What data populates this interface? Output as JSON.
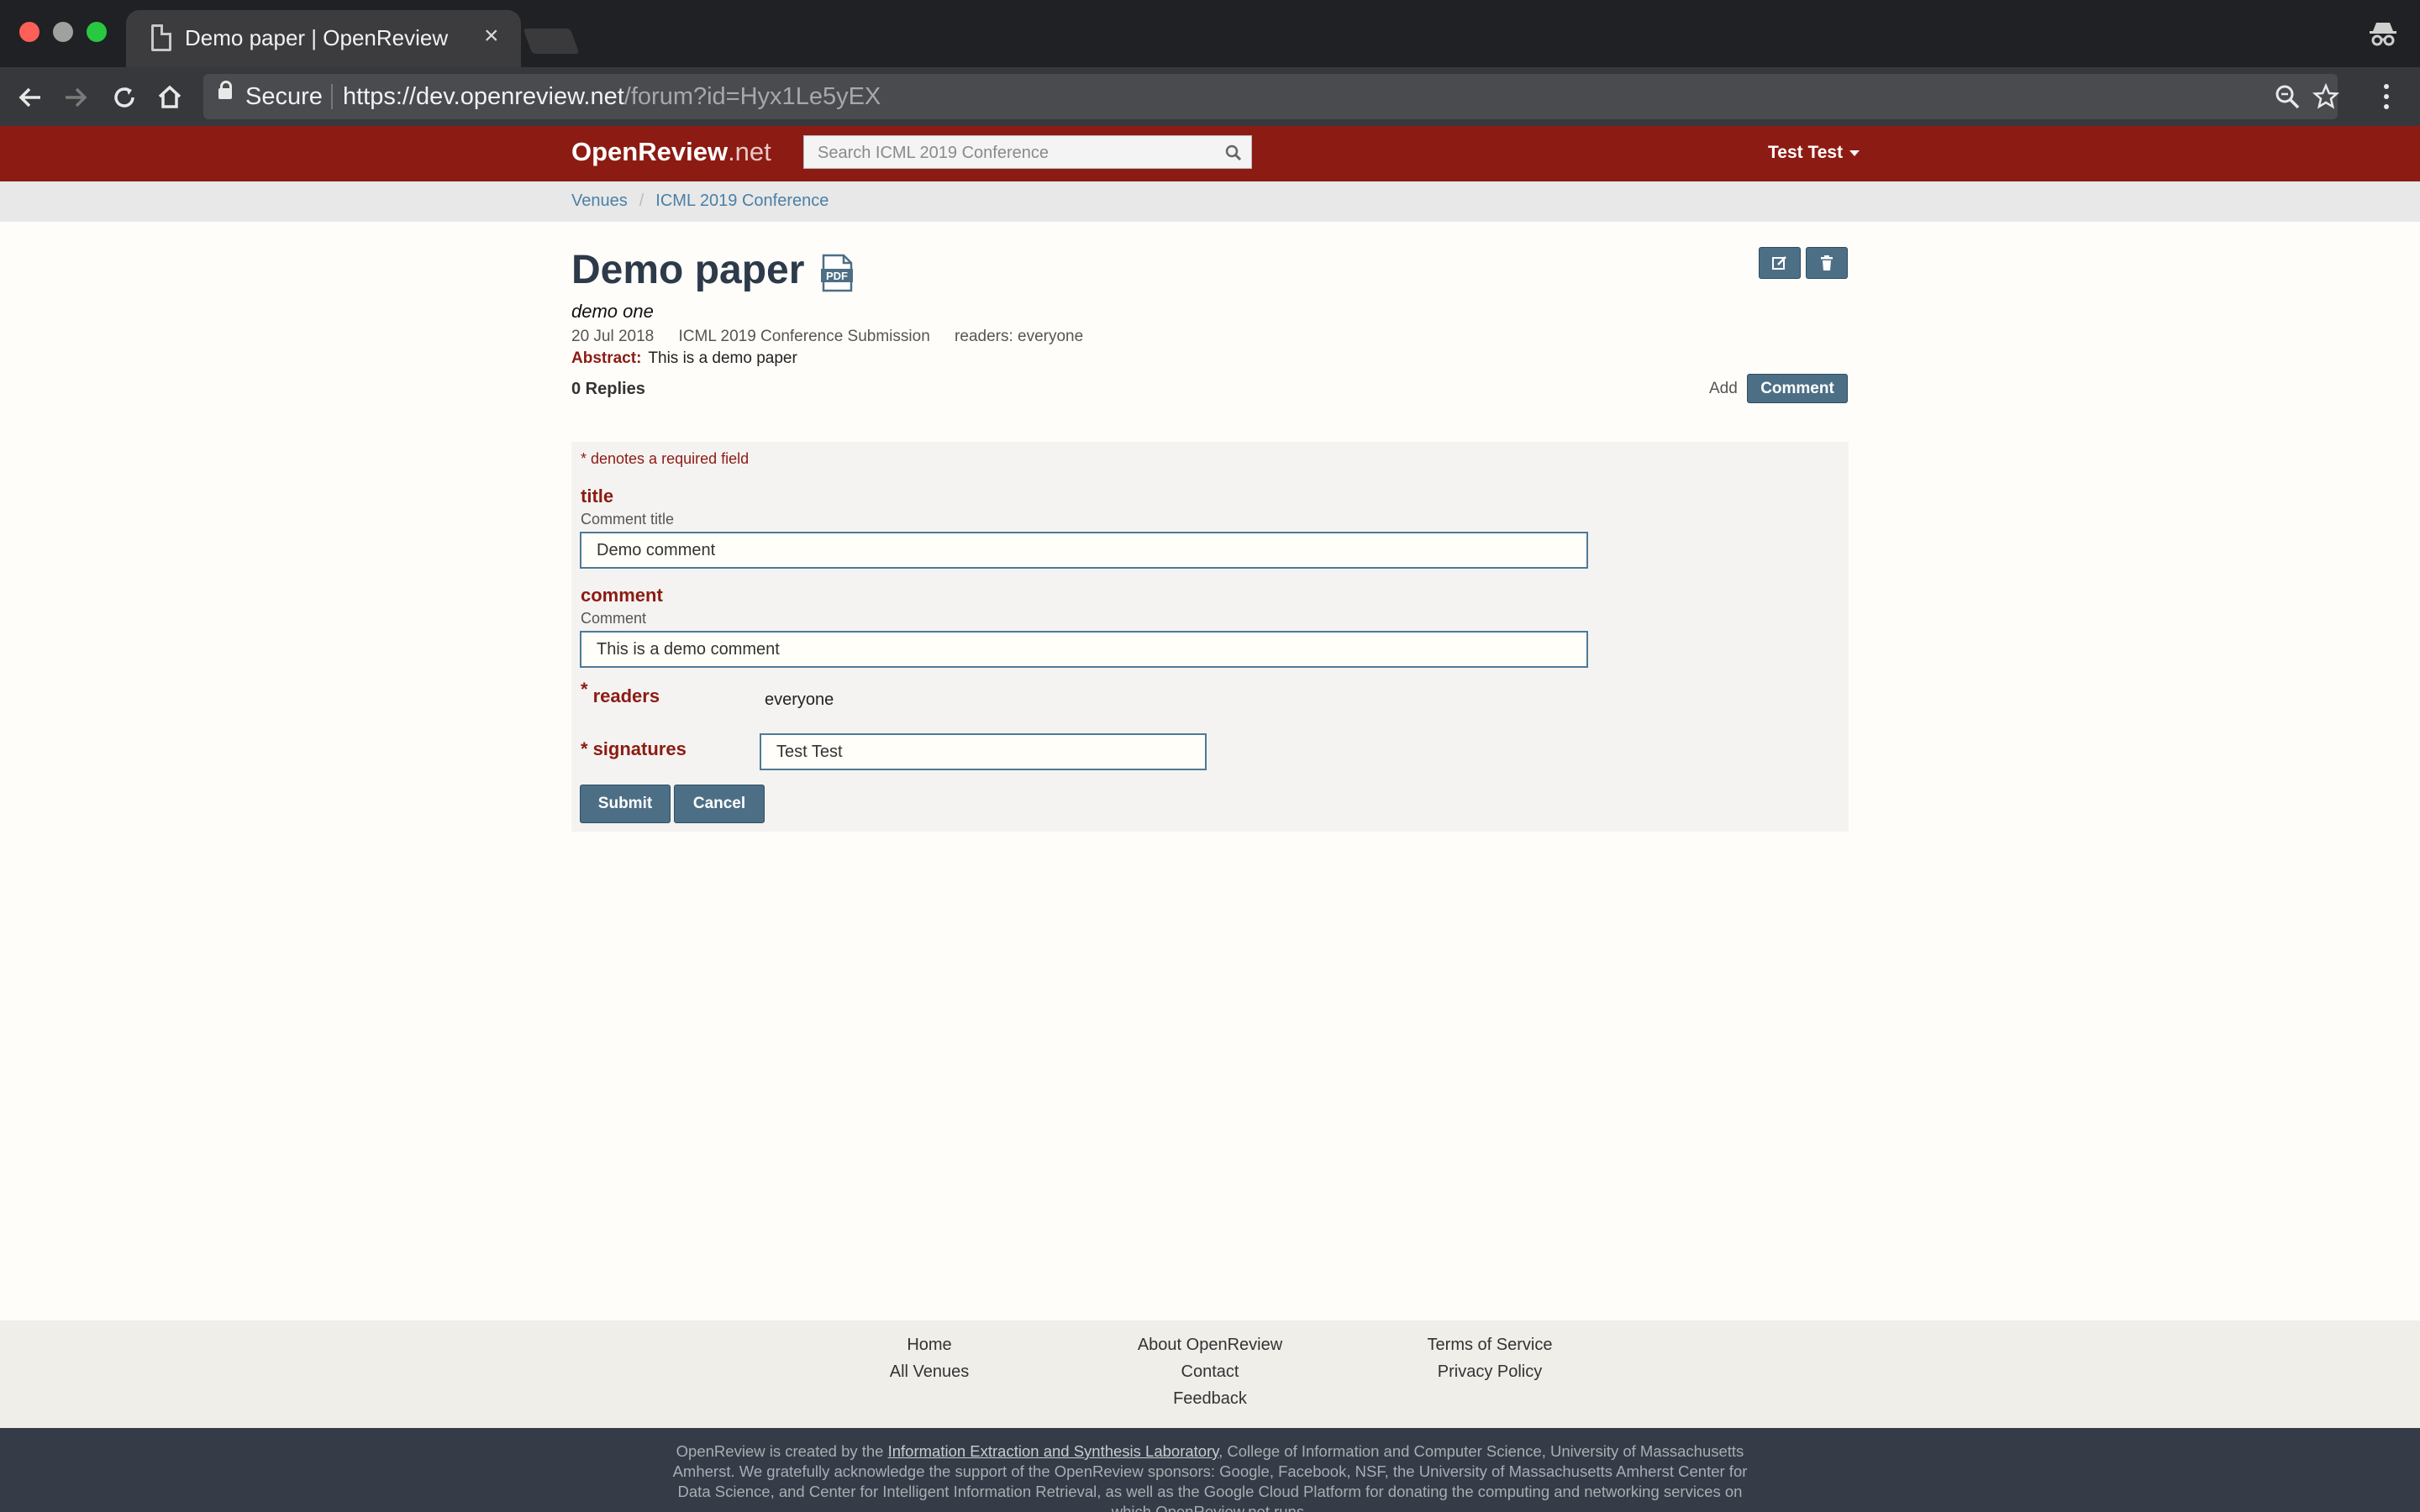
{
  "browser": {
    "tab_title": "Demo paper | OpenReview",
    "secure_label": "Secure",
    "url_main": "https://dev.openreview.net",
    "url_path": "/forum?id=Hyx1Le5yEX"
  },
  "header": {
    "brand_main": "OpenReview",
    "brand_suffix": ".net",
    "search_placeholder": "Search ICML 2019 Conference",
    "user_name": "Test Test"
  },
  "breadcrumb": [
    "Venues",
    "ICML 2019 Conference"
  ],
  "note": {
    "title": "Demo paper",
    "authors": "demo one",
    "date": "20 Jul 2018",
    "invitation": "ICML 2019 Conference Submission",
    "readers": "readers: everyone",
    "abstract_label": "Abstract:",
    "abstract": "This is a demo paper",
    "replies": "0 Replies",
    "add_label": "Add",
    "comment_button": "Comment"
  },
  "form": {
    "required_note": "* denotes a required field",
    "title_label": "title",
    "title_desc": "Comment title",
    "title_value": "Demo comment",
    "comment_label": "comment",
    "comment_desc": "Comment",
    "comment_value": "This is a demo comment",
    "readers_star": "*",
    "readers_label": "readers",
    "readers_value": "everyone",
    "signatures_star": "*",
    "signatures_label": "signatures",
    "signatures_value": "Test Test",
    "submit": "Submit",
    "cancel": "Cancel"
  },
  "footer": {
    "col1": [
      "Home",
      "All Venues"
    ],
    "col2": [
      "About OpenReview",
      "Contact",
      "Feedback"
    ],
    "col3": [
      "Terms of Service",
      "Privacy Policy"
    ],
    "sponsor_pre": "OpenReview is created by the ",
    "sponsor_lab": "Information Extraction and Synthesis Laboratory",
    "sponsor_post": ", College of Information and Computer Science, University of Massachusetts Amherst. We gratefully acknowledge the support of the OpenReview sponsors: Google, Facebook, NSF, the University of Massachusetts Amherst Center for Data Science, and Center for Intelligent Information Retrieval, as well as the Google Cloud Platform for donating the computing and networking services on which OpenReview.net runs."
  },
  "colors": {
    "brand_red": "#8c1b13",
    "button_blue": "#4d6f86",
    "link_blue": "#4b7fa6"
  }
}
